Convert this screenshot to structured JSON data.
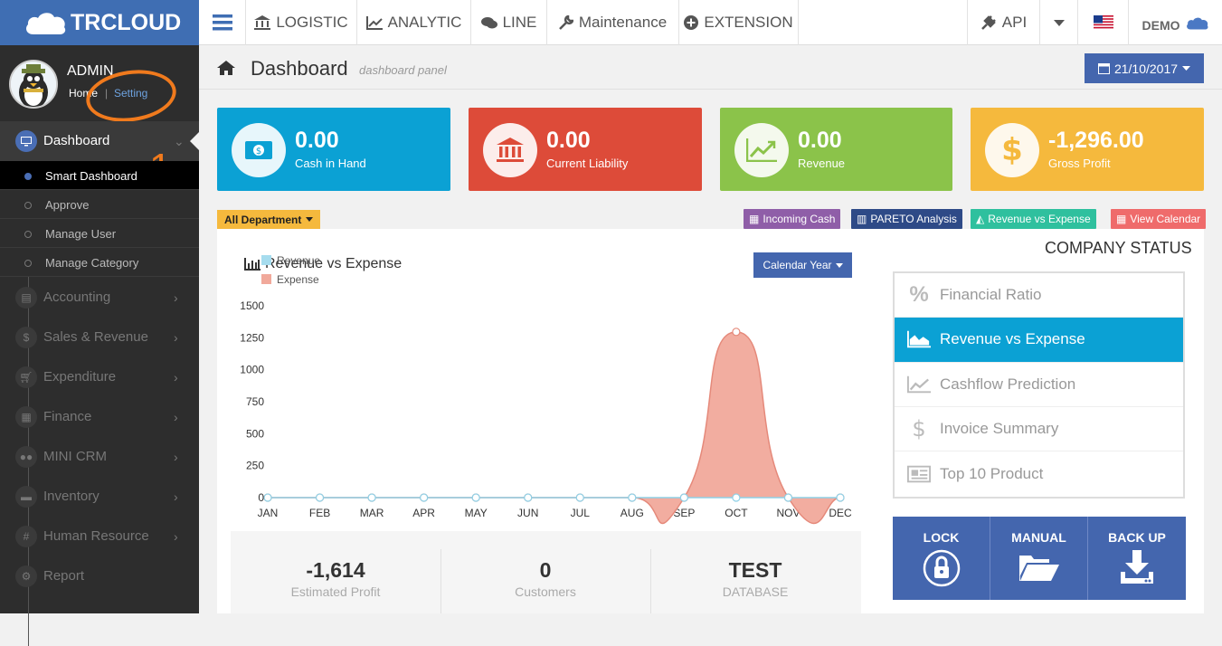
{
  "brand": {
    "name": "TRCLOUD"
  },
  "topnav": [
    {
      "label": "LOGISTIC",
      "icon": "bank-icon"
    },
    {
      "label": "ANALYTIC",
      "icon": "line-chart-icon"
    },
    {
      "label": "LINE",
      "icon": "chat-icon"
    },
    {
      "label": "Maintenance",
      "icon": "wrench-icon"
    },
    {
      "label": "EXTENSION",
      "icon": "plus-circle-icon"
    }
  ],
  "topright": {
    "api_label": "API",
    "user_label": "DEMO"
  },
  "profile": {
    "name": "ADMIN",
    "home": "Home",
    "sep": "|",
    "setting": "Setting"
  },
  "annotation": {
    "number": "1"
  },
  "sidebar": {
    "active": {
      "label": "Dashboard"
    },
    "subitems": [
      "Smart Dashboard",
      "Approve",
      "Manage User",
      "Manage Category"
    ],
    "items": [
      {
        "label": "Accounting",
        "icon": "book-icon"
      },
      {
        "label": "Sales & Revenue",
        "icon": "dollar-icon"
      },
      {
        "label": "Expenditure",
        "icon": "cart-icon"
      },
      {
        "label": "Finance",
        "icon": "calendar-icon"
      },
      {
        "label": "MINI CRM",
        "icon": "users-icon"
      },
      {
        "label": "Inventory",
        "icon": "truck-icon"
      },
      {
        "label": "Human Resource",
        "icon": "hash-icon"
      },
      {
        "label": "Report",
        "icon": "settings-icon"
      }
    ]
  },
  "header": {
    "title": "Dashboard",
    "subtitle": "dashboard panel",
    "date": "21/10/2017"
  },
  "stats": [
    {
      "value": "0.00",
      "label": "Cash in Hand",
      "color": "#0ba1d4"
    },
    {
      "value": "0.00",
      "label": "Current Liability",
      "color": "#dd4b39"
    },
    {
      "value": "0.00",
      "label": "Revenue",
      "color": "#8bc34a"
    },
    {
      "value": "-1,296.00",
      "label": "Gross Profit",
      "color": "#f5b93d"
    }
  ],
  "filters": {
    "department": "All Department",
    "links": [
      {
        "label": "Incoming Cash",
        "color": "#8f5ea8"
      },
      {
        "label": "PARETO Analysis",
        "color": "#2e4a87"
      },
      {
        "label": "Revenue vs Expense",
        "color": "#2fc09e"
      },
      {
        "label": "View Calendar",
        "color": "#ef6b6b"
      }
    ]
  },
  "chart_panel": {
    "title": "Revenue vs Expense",
    "period": "Calendar Year"
  },
  "chart_data": {
    "type": "area",
    "categories": [
      "JAN",
      "FEB",
      "MAR",
      "APR",
      "MAY",
      "JUN",
      "JUL",
      "AUG",
      "SEP",
      "OCT",
      "NOV",
      "DEC"
    ],
    "series": [
      {
        "name": "Revenue",
        "values": [
          0,
          0,
          0,
          0,
          0,
          0,
          0,
          0,
          0,
          0,
          0,
          0
        ],
        "color": "#a6dcee"
      },
      {
        "name": "Expense",
        "values": [
          0,
          0,
          0,
          0,
          0,
          0,
          0,
          0,
          0,
          1296,
          0,
          0
        ],
        "color": "#f1a99b"
      }
    ],
    "ylim": [
      0,
      1500
    ],
    "yticks": [
      "1500",
      "1250",
      "1000",
      "750",
      "500",
      "250",
      "0"
    ],
    "legend": "top-left"
  },
  "summary": [
    {
      "value": "-1,614",
      "label": "Estimated Profit"
    },
    {
      "value": "0",
      "label": "Customers"
    },
    {
      "value": "TEST",
      "label": "DATABASE"
    }
  ],
  "company_status": {
    "title": "COMPANY STATUS",
    "items": [
      {
        "label": "Financial Ratio",
        "icon": "percent-icon"
      },
      {
        "label": "Revenue vs Expense",
        "icon": "area-chart-icon",
        "active": true
      },
      {
        "label": "Cashflow Prediction",
        "icon": "line-chart-icon"
      },
      {
        "label": "Invoice Summary",
        "icon": "dollar-icon"
      },
      {
        "label": "Top 10 Product",
        "icon": "newspaper-icon"
      }
    ]
  },
  "actions": [
    {
      "label": "LOCK",
      "icon": "lock-icon"
    },
    {
      "label": "MANUAL",
      "icon": "folder-open-icon"
    },
    {
      "label": "BACK UP",
      "icon": "download-icon"
    }
  ]
}
